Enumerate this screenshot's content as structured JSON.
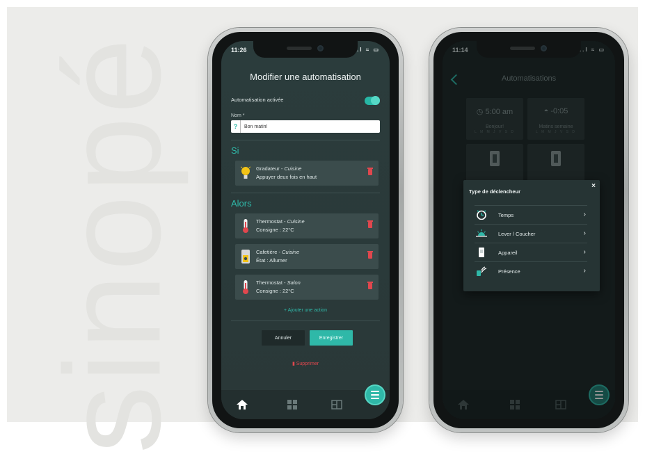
{
  "brand": "sinopé",
  "phone1": {
    "status": {
      "time": "11:26",
      "icons": "..l ≈ ▭"
    },
    "title": "Modifier une automatisation",
    "enabled_label": "Automatisation activée",
    "enabled": true,
    "name_label": "Nom *",
    "name_help": "?",
    "name_value": "Bon matin!",
    "if_heading": "Si",
    "triggers": [
      {
        "device": "Gradateur",
        "room": "Cuisine",
        "detail": "Appuyer deux fois en haut",
        "icon": "bulb-icon"
      }
    ],
    "then_heading": "Alors",
    "actions": [
      {
        "device": "Thermostat",
        "room": "Cuisine",
        "detail": "Consigne : 22°C",
        "icon": "thermometer-icon"
      },
      {
        "device": "Cafetière",
        "room": "Cuisine",
        "detail": "État : Allumer",
        "icon": "plug-icon"
      },
      {
        "device": "Thermostat",
        "room": "Salon",
        "detail": "Consigne : 22°C",
        "icon": "thermometer-icon"
      }
    ],
    "add_action": "+ Ajouter une action",
    "cancel": "Annuler",
    "save": "Enregistrer",
    "delete": "Supprimer",
    "colors": {
      "accent": "#2fb8a8",
      "danger": "#e0474e",
      "bg": "#2b3c3c"
    }
  },
  "phone2": {
    "status": {
      "time": "11:14",
      "icons": "..l ≈ ▭"
    },
    "title": "Automatisations",
    "tiles": [
      {
        "value": "5:00 am",
        "label": "Bonjour!",
        "days": "L M M J V S D",
        "icon": "clock-icon"
      },
      {
        "value": "-0:05",
        "label": "Matins semaine",
        "days": "L M M J V S D",
        "icon": "sunrise-icon"
      }
    ],
    "modal": {
      "title": "Type de déclencheur",
      "close": "×",
      "options": [
        {
          "label": "Temps",
          "icon": "clock-icon"
        },
        {
          "label": "Lever / Coucher",
          "icon": "sunrise-icon"
        },
        {
          "label": "Appareil",
          "icon": "device-icon"
        },
        {
          "label": "Présence",
          "icon": "presence-icon"
        }
      ]
    }
  }
}
